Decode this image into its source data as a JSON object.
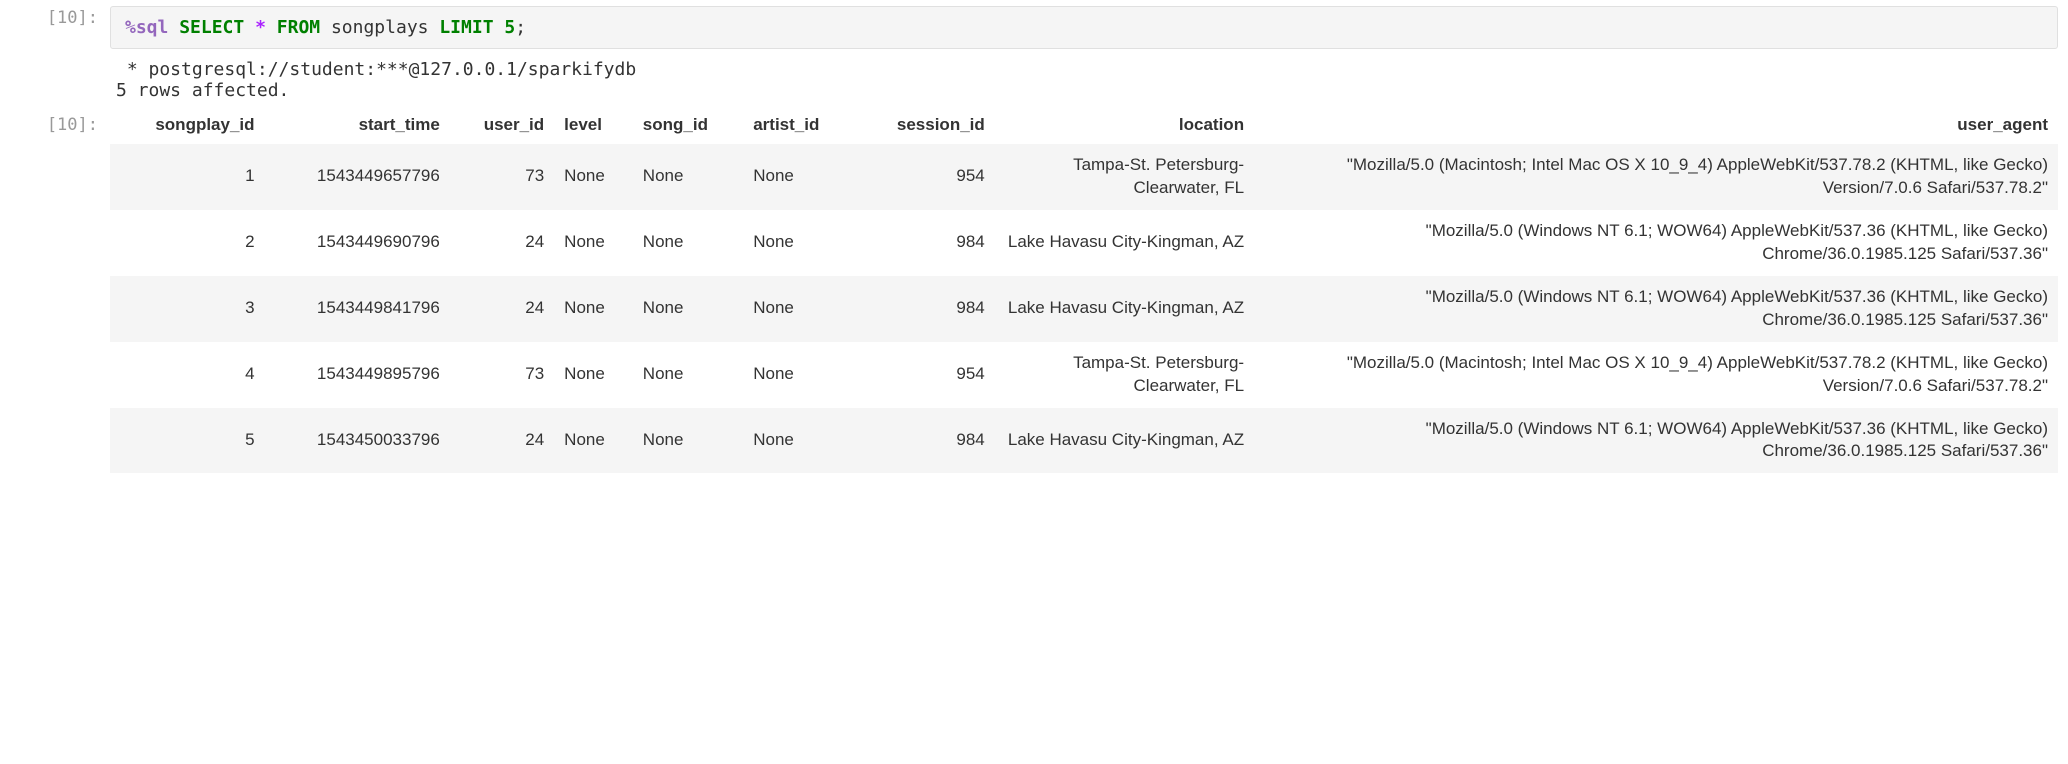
{
  "input_prompt": "[10]:",
  "output_text_prompt": "",
  "output_prompt": "[10]:",
  "code": {
    "magic": "%sql",
    "rest_tokens": [
      {
        "t": " ",
        "c": ""
      },
      {
        "t": "SELECT",
        "c": "kw"
      },
      {
        "t": " ",
        "c": ""
      },
      {
        "t": "*",
        "c": "op"
      },
      {
        "t": " ",
        "c": ""
      },
      {
        "t": "FROM",
        "c": "kw"
      },
      {
        "t": " songplays ",
        "c": ""
      },
      {
        "t": "LIMIT",
        "c": "kw"
      },
      {
        "t": " ",
        "c": ""
      },
      {
        "t": "5",
        "c": "num"
      },
      {
        "t": ";",
        "c": ""
      }
    ]
  },
  "stdout_lines": [
    " * postgresql://student:***@127.0.0.1/sparkifydb",
    "5 rows affected."
  ],
  "table": {
    "columns": [
      {
        "key": "songplay_id",
        "label": "songplay_id",
        "align": "right"
      },
      {
        "key": "start_time",
        "label": "start_time",
        "align": "right"
      },
      {
        "key": "user_id",
        "label": "user_id",
        "align": "right"
      },
      {
        "key": "level",
        "label": "level",
        "align": "left"
      },
      {
        "key": "song_id",
        "label": "song_id",
        "align": "left"
      },
      {
        "key": "artist_id",
        "label": "artist_id",
        "align": "left"
      },
      {
        "key": "session_id",
        "label": "session_id",
        "align": "right"
      },
      {
        "key": "location",
        "label": "location",
        "align": "right",
        "cls": "col-location"
      },
      {
        "key": "user_agent",
        "label": "user_agent",
        "align": "right",
        "cls": "col-ua"
      }
    ],
    "rows": [
      {
        "songplay_id": "1",
        "start_time": "1543449657796",
        "user_id": "73",
        "level": "None",
        "song_id": "None",
        "artist_id": "None",
        "session_id": "954",
        "location": "Tampa-St. Petersburg-Clearwater, FL",
        "user_agent": "\"Mozilla/5.0 (Macintosh; Intel Mac OS X 10_9_4) AppleWebKit/537.78.2 (KHTML, like Gecko) Version/7.0.6 Safari/537.78.2\""
      },
      {
        "songplay_id": "2",
        "start_time": "1543449690796",
        "user_id": "24",
        "level": "None",
        "song_id": "None",
        "artist_id": "None",
        "session_id": "984",
        "location": "Lake Havasu City-Kingman, AZ",
        "user_agent": "\"Mozilla/5.0 (Windows NT 6.1; WOW64) AppleWebKit/537.36 (KHTML, like Gecko) Chrome/36.0.1985.125 Safari/537.36\""
      },
      {
        "songplay_id": "3",
        "start_time": "1543449841796",
        "user_id": "24",
        "level": "None",
        "song_id": "None",
        "artist_id": "None",
        "session_id": "984",
        "location": "Lake Havasu City-Kingman, AZ",
        "user_agent": "\"Mozilla/5.0 (Windows NT 6.1; WOW64) AppleWebKit/537.36 (KHTML, like Gecko) Chrome/36.0.1985.125 Safari/537.36\""
      },
      {
        "songplay_id": "4",
        "start_time": "1543449895796",
        "user_id": "73",
        "level": "None",
        "song_id": "None",
        "artist_id": "None",
        "session_id": "954",
        "location": "Tampa-St. Petersburg-Clearwater, FL",
        "user_agent": "\"Mozilla/5.0 (Macintosh; Intel Mac OS X 10_9_4) AppleWebKit/537.78.2 (KHTML, like Gecko) Version/7.0.6 Safari/537.78.2\""
      },
      {
        "songplay_id": "5",
        "start_time": "1543450033796",
        "user_id": "24",
        "level": "None",
        "song_id": "None",
        "artist_id": "None",
        "session_id": "984",
        "location": "Lake Havasu City-Kingman, AZ",
        "user_agent": "\"Mozilla/5.0 (Windows NT 6.1; WOW64) AppleWebKit/537.36 (KHTML, like Gecko) Chrome/36.0.1985.125 Safari/537.36\""
      }
    ]
  }
}
